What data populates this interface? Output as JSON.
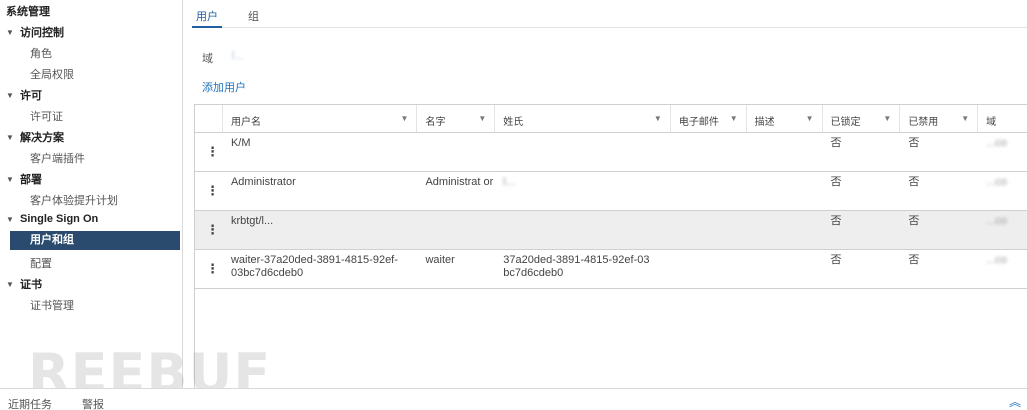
{
  "sidebar": {
    "title": "系统管理",
    "groups": [
      {
        "label": "访问控制",
        "items": [
          "角色",
          "全局权限"
        ]
      },
      {
        "label": "许可",
        "items": [
          "许可证"
        ]
      },
      {
        "label": "解决方案",
        "items": [
          "客户端插件"
        ]
      },
      {
        "label": "部署",
        "items": [
          "客户体验提升计划"
        ]
      },
      {
        "label": "Single Sign On",
        "items": [
          "用户和组",
          "配置"
        ]
      },
      {
        "label": "证书",
        "items": [
          "证书管理"
        ]
      }
    ],
    "selected_item": "用户和组"
  },
  "tabs": [
    {
      "label": "用户",
      "active": true
    },
    {
      "label": "组",
      "active": false
    }
  ],
  "domain": {
    "label": "域",
    "value": "l..."
  },
  "add_user_label": "添加用户",
  "table": {
    "columns": [
      "用户名",
      "名字",
      "姓氏",
      "电子邮件",
      "描述",
      "已锁定",
      "已禁用",
      "域"
    ],
    "rows": [
      {
        "username": "K/M",
        "first": "",
        "last": "",
        "email": "",
        "desc": "",
        "locked": "否",
        "disabled": "否",
        "domain": "...co"
      },
      {
        "username": "Administrator",
        "first": "Administrat or",
        "last": "l...",
        "email": "",
        "desc": "",
        "locked": "否",
        "disabled": "否",
        "domain": "...co"
      },
      {
        "username": "krbtgt/l...",
        "first": "",
        "last": "",
        "email": "",
        "desc": "",
        "locked": "否",
        "disabled": "否",
        "domain": "...co"
      },
      {
        "username": "waiter-37a20ded-3891-4815-92ef-03bc7d6cdeb0",
        "first": "waiter",
        "last": "37a20ded-3891-4815-92ef-03 bc7d6cdeb0",
        "email": "",
        "desc": "",
        "locked": "否",
        "disabled": "否",
        "domain": "...co"
      }
    ]
  },
  "bottombar": {
    "recent_tasks": "近期任务",
    "alarms": "警报"
  },
  "watermark": "REEBUF"
}
